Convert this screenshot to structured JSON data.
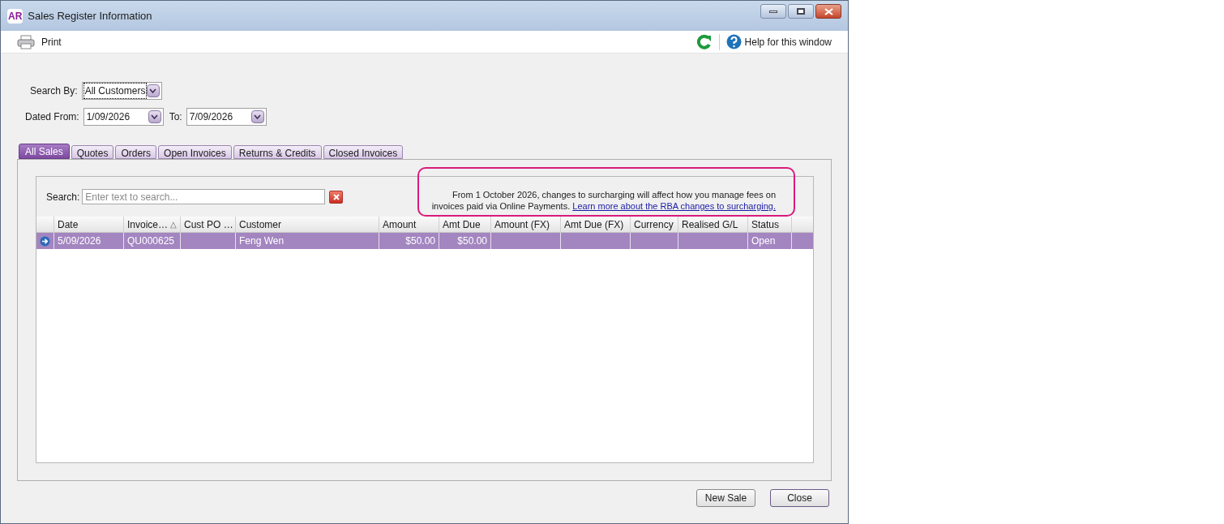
{
  "window": {
    "app_badge": "AR",
    "title": "Sales Register Information"
  },
  "toolbar": {
    "print": "Print",
    "help": "Help for this window"
  },
  "filters": {
    "search_by_label": "Search By:",
    "search_by_value": "All Customers",
    "dated_from_label": "Dated From:",
    "dated_from_value": "1/09/2026",
    "to_label": "To:",
    "to_value": "7/09/2026"
  },
  "tabs": [
    {
      "label": "All Sales",
      "selected": true
    },
    {
      "label": "Quotes",
      "selected": false
    },
    {
      "label": "Orders",
      "selected": false
    },
    {
      "label": "Open Invoices",
      "selected": false
    },
    {
      "label": "Returns & Credits",
      "selected": false
    },
    {
      "label": "Closed Invoices",
      "selected": false
    }
  ],
  "search": {
    "label": "Search:",
    "placeholder": "Enter text to search..."
  },
  "notice": {
    "text": "From 1 October 2026, changes to surcharging will affect how you manage fees on invoices paid via Online Payments.",
    "link": "Learn more about the RBA changes to surcharging.",
    "highlighted": true
  },
  "table": {
    "columns": [
      "Date",
      "Invoice…",
      "Cust PO …",
      "Customer",
      "Amount",
      "Amt Due",
      "Amount (FX)",
      "Amt Due (FX)",
      "Currency",
      "Realised G/L",
      "Status"
    ],
    "sort_column_icon": "△",
    "rows": [
      {
        "selected": true,
        "cells": [
          "5/09/2026",
          "QU000625",
          "",
          "Feng Wen",
          "$50.00",
          "$50.00",
          "",
          "",
          "",
          "",
          "Open"
        ]
      }
    ]
  },
  "buttons": [
    "New Sale",
    "Close"
  ]
}
